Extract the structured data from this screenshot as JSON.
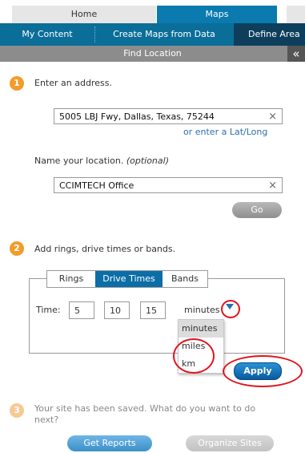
{
  "top_tabs": {
    "home": "Home",
    "maps": "Maps"
  },
  "subnav": {
    "my_content": "My Content",
    "create_maps": "Create Maps from Data",
    "define_areas": "Define Area"
  },
  "header": {
    "title": "Find Location",
    "collapse_glyph": "«"
  },
  "step1": {
    "number": "1",
    "prompt": "Enter an address.",
    "address_value": "5005 LBJ Fwy, Dallas, Texas, 75244",
    "clear_glyph": "×",
    "latlong_link": "or enter a Lat/Long",
    "name_prompt": "Name your location.",
    "name_optional": "(optional)",
    "name_value": "CCIMTECH Office",
    "go_label": "Go"
  },
  "step2": {
    "number": "2",
    "prompt": "Add rings, drive times or bands.",
    "tabs": [
      "Rings",
      "Drive Times",
      "Bands"
    ],
    "active_tab": "Drive Times",
    "time_label": "Time:",
    "times": [
      "5",
      "10",
      "15"
    ],
    "unit": "minutes",
    "unit_options": [
      "minutes",
      "miles",
      "km"
    ],
    "apply_label": "Apply"
  },
  "step3": {
    "number": "3",
    "message": "Your site has been saved. What do you want to do next?",
    "get_reports": "Get Reports",
    "organize_sites": "Organize Sites"
  },
  "colors": {
    "accent_blue": "#0a7aaf",
    "step_orange": "#f39c2a",
    "annotation_red": "#e0141c"
  }
}
